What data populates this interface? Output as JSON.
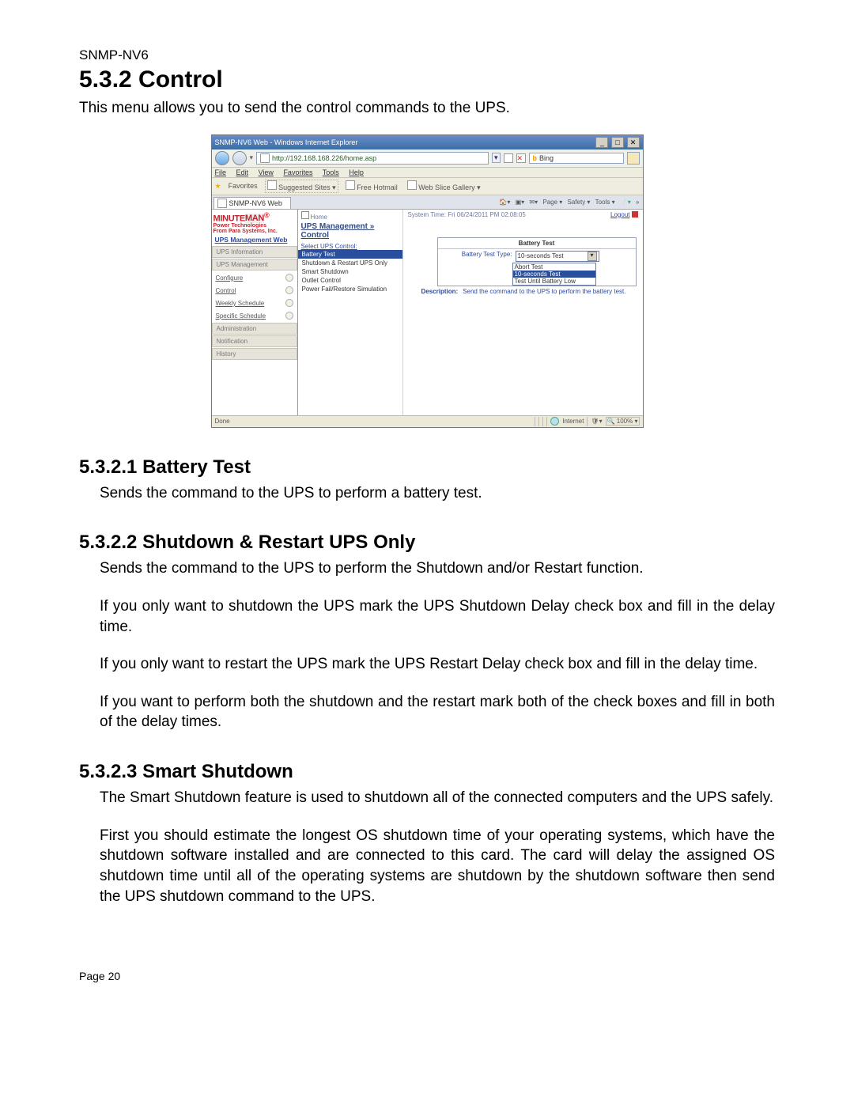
{
  "header": "SNMP-NV6",
  "section_title": "5.3.2 Control",
  "intro": "This menu allows you to send the control commands to the UPS.",
  "sub1": {
    "title": "5.3.2.1 Battery Test",
    "p1": "Sends the command to the UPS to perform a battery test."
  },
  "sub2": {
    "title": "5.3.2.2 Shutdown & Restart UPS Only",
    "p1": "Sends the command to the UPS to perform the Shutdown and/or Restart function.",
    "p2": "If you only want to shutdown the UPS mark the UPS Shutdown Delay check box and fill in the delay time.",
    "p3": "If you only want to restart the UPS mark the UPS Restart Delay check box and fill in the delay time.",
    "p4": "If you want to perform both the shutdown and the restart mark both of the check boxes and fill in both of the delay times."
  },
  "sub3": {
    "title": "5.3.2.3 Smart Shutdown",
    "p1": "The Smart Shutdown feature is used to shutdown all of the connected computers and the UPS safely.",
    "p2": "First you should estimate the longest OS shutdown time of your operating systems, which have the shutdown software installed and are connected to this card. The card will delay the assigned OS shutdown time until all of the operating systems are shutdown by the shutdown software then send the UPS shutdown command to the UPS."
  },
  "footer": "Page 20",
  "shot": {
    "title": "SNMP-NV6 Web - Windows Internet Explorer",
    "url": "http://192.168.168.226/home.asp",
    "search_engine": "Bing",
    "menu": {
      "file": "File",
      "edit": "Edit",
      "view": "View",
      "favorites": "Favorites",
      "tools": "Tools",
      "help": "Help"
    },
    "favbar": {
      "label": "Favorites",
      "suggested": "Suggested Sites ▾",
      "hotmail": "Free Hotmail",
      "gallery": "Web Slice Gallery ▾"
    },
    "tab_label": "SNMP-NV6 Web",
    "toolbar_links": [
      "Page ▾",
      "Safety ▾",
      "Tools ▾"
    ],
    "brand1": "MINUTE",
    "brand2": "MAN",
    "brand_sub1": "Power Technologies",
    "brand_sub2": "From Para Systems, Inc.",
    "side_title": "UPS Management Web",
    "side_items": {
      "ups_info": "UPS Information",
      "ups_mgmt": "UPS Management",
      "configure": "Configure",
      "control": "Control",
      "weekly": "Weekly Schedule",
      "specific": "Specific Schedule",
      "admin": "Administration",
      "notif": "Notification",
      "history": "History"
    },
    "crumb_home": "Home",
    "crumb_title": "UPS Management » Control",
    "select_label": "Select UPS Control:",
    "controls": {
      "battery": "Battery Test",
      "shutdown": "Shutdown & Restart UPS Only",
      "smart": "Smart Shutdown",
      "outlet": "Outlet Control",
      "powerfail": "Power Fail/Restore Simulation"
    },
    "system_time_label": "System Time: ",
    "system_time": "Fri 06/24/2011 PM 02:08:05",
    "logout": "Logout",
    "panel": {
      "title": "Battery Test",
      "type_label": "Battery Test Type:",
      "selected": "10-seconds Test",
      "opts": {
        "abort": "Abort Test",
        "ten": "10-seconds Test",
        "until": "Test Until Battery Low"
      },
      "desc_label": "Description:",
      "desc": "Send the command to the UPS to perform the battery test."
    },
    "status": {
      "done": "Done",
      "internet": "Internet",
      "zoom": "100%"
    }
  }
}
